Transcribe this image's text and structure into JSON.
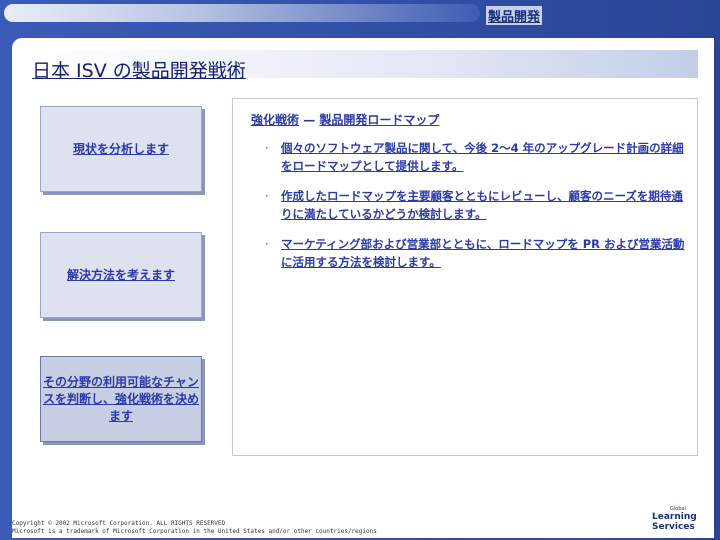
{
  "header": {
    "section_tag": "製品開発"
  },
  "title": "日本 ISV の製品開発戦術",
  "steps": [
    {
      "label": "現状を分析します"
    },
    {
      "label": "解決方法を考えます"
    },
    {
      "label": "その分野の利用可能なチャンスを判断し、強化戦術を決めます"
    }
  ],
  "panel": {
    "title_left": "強化戦術",
    "title_dash": " — ",
    "title_right": "製品開発ロードマップ",
    "bullets": [
      "個々のソフトウェア製品に関して、今後 2～4 年のアップグレード計画の詳細をロードマップとして提供します。",
      "作成したロードマップを主要顧客とともにレビューし、顧客のニーズを期待通りに満たしているかどうか検討します。",
      "マーケティング部および営業部とともに、ロードマップを PR および営業活動に活用する方法を検討します。"
    ]
  },
  "footer": {
    "copyright_line1": "Copyright © 2002 Microsoft Corporation. ALL RIGHTS RESERVED",
    "copyright_line2": "Microsoft is a trademark of Microsoft Corporation in the United States and/or other countries/regions",
    "logo_small": "Global",
    "logo_line1": "Learning",
    "logo_line2": "Services"
  }
}
